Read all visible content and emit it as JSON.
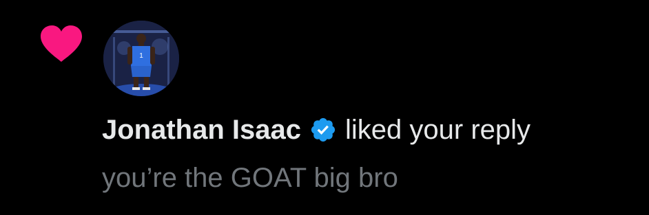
{
  "notification": {
    "type_icon": "heart-icon",
    "avatar_icon": "user-avatar-photo",
    "user_name": "Jonathan Isaac",
    "verified_icon": "verified-badge-icon",
    "action_text": "liked your reply",
    "reply_text": "you’re the GOAT big bro"
  },
  "colors": {
    "background": "#000000",
    "heart": "#f91880",
    "primary_text": "#e7e9ea",
    "secondary_text": "#71767b",
    "verified": "#1d9bf0"
  }
}
